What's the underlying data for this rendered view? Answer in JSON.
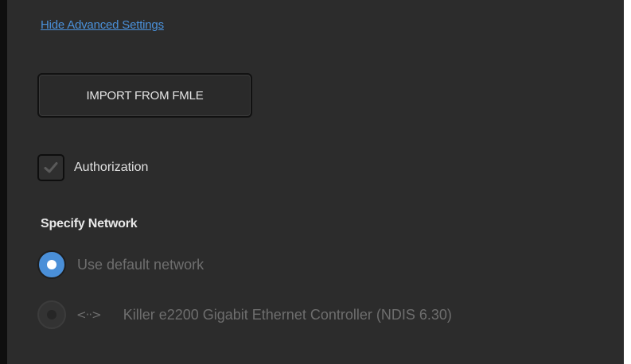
{
  "advanced": {
    "toggle_link": "Hide Advanced Settings"
  },
  "import": {
    "button_label": "IMPORT FROM FMLE"
  },
  "authorization": {
    "label": "Authorization",
    "checked": true
  },
  "network": {
    "section_title": "Specify Network",
    "options": [
      {
        "label": "Use default network",
        "selected": true
      },
      {
        "label": "Killer e2200 Gigabit Ethernet Controller (NDIS 6.30)",
        "selected": false,
        "icon": "network-adapter-icon"
      }
    ],
    "adapter_icon_glyph": "<··>"
  },
  "colors": {
    "panel_bg": "#2c2c2c",
    "link": "#4a90d9",
    "accent": "#4a8fd8",
    "disabled_text": "#6e6e6e"
  }
}
